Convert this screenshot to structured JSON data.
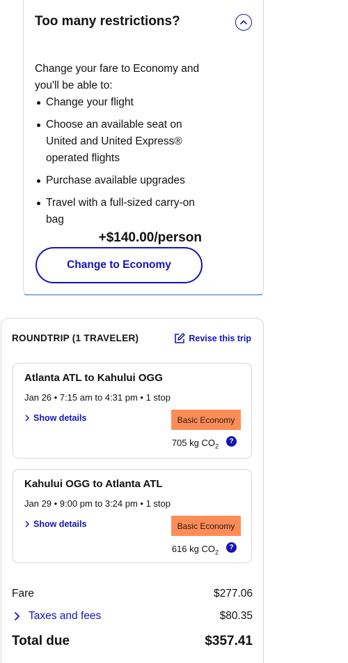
{
  "restrictions": {
    "title": "Too many restrictions?",
    "intro": "Change your fare to Economy and you'll be able to:",
    "benefits": [
      "Change your flight",
      "Choose an available seat on United and United Express® operated flights",
      "Purchase available upgrades",
      "Travel with a full-sized carry-on bag"
    ],
    "price_per_person": "+$140.00/person",
    "change_button_label": "Change to Economy",
    "collapse_icon": "chevron-up-circle-icon"
  },
  "trip": {
    "header": "ROUNDTRIP (1 TRAVELER)",
    "revise_label": "Revise this trip",
    "flights": [
      {
        "route": "Atlanta ATL to Kahului OGG",
        "times": "Jan 26 • 7:15 am to 4:31 pm • 1 stop",
        "details_label": "Show details",
        "fare_class": "Basic Economy",
        "co2_value": "705 kg CO",
        "co2_sub": "2"
      },
      {
        "route": "Kahului OGG to Atlanta ATL",
        "times": "Jan 29 • 9:00 pm to 3:24 pm • 1 stop",
        "details_label": "Show details",
        "fare_class": "Basic Economy",
        "co2_value": "616 kg CO",
        "co2_sub": "2"
      }
    ],
    "pricing": {
      "fare_label": "Fare",
      "fare_value": "$277.06",
      "taxes_label": "Taxes and fees",
      "taxes_value": "$80.35",
      "total_label": "Total due",
      "total_value": "$357.41"
    }
  },
  "colors": {
    "accent": "#1414b8",
    "badge": "#ff8c57",
    "border": "#d5d8dc"
  }
}
